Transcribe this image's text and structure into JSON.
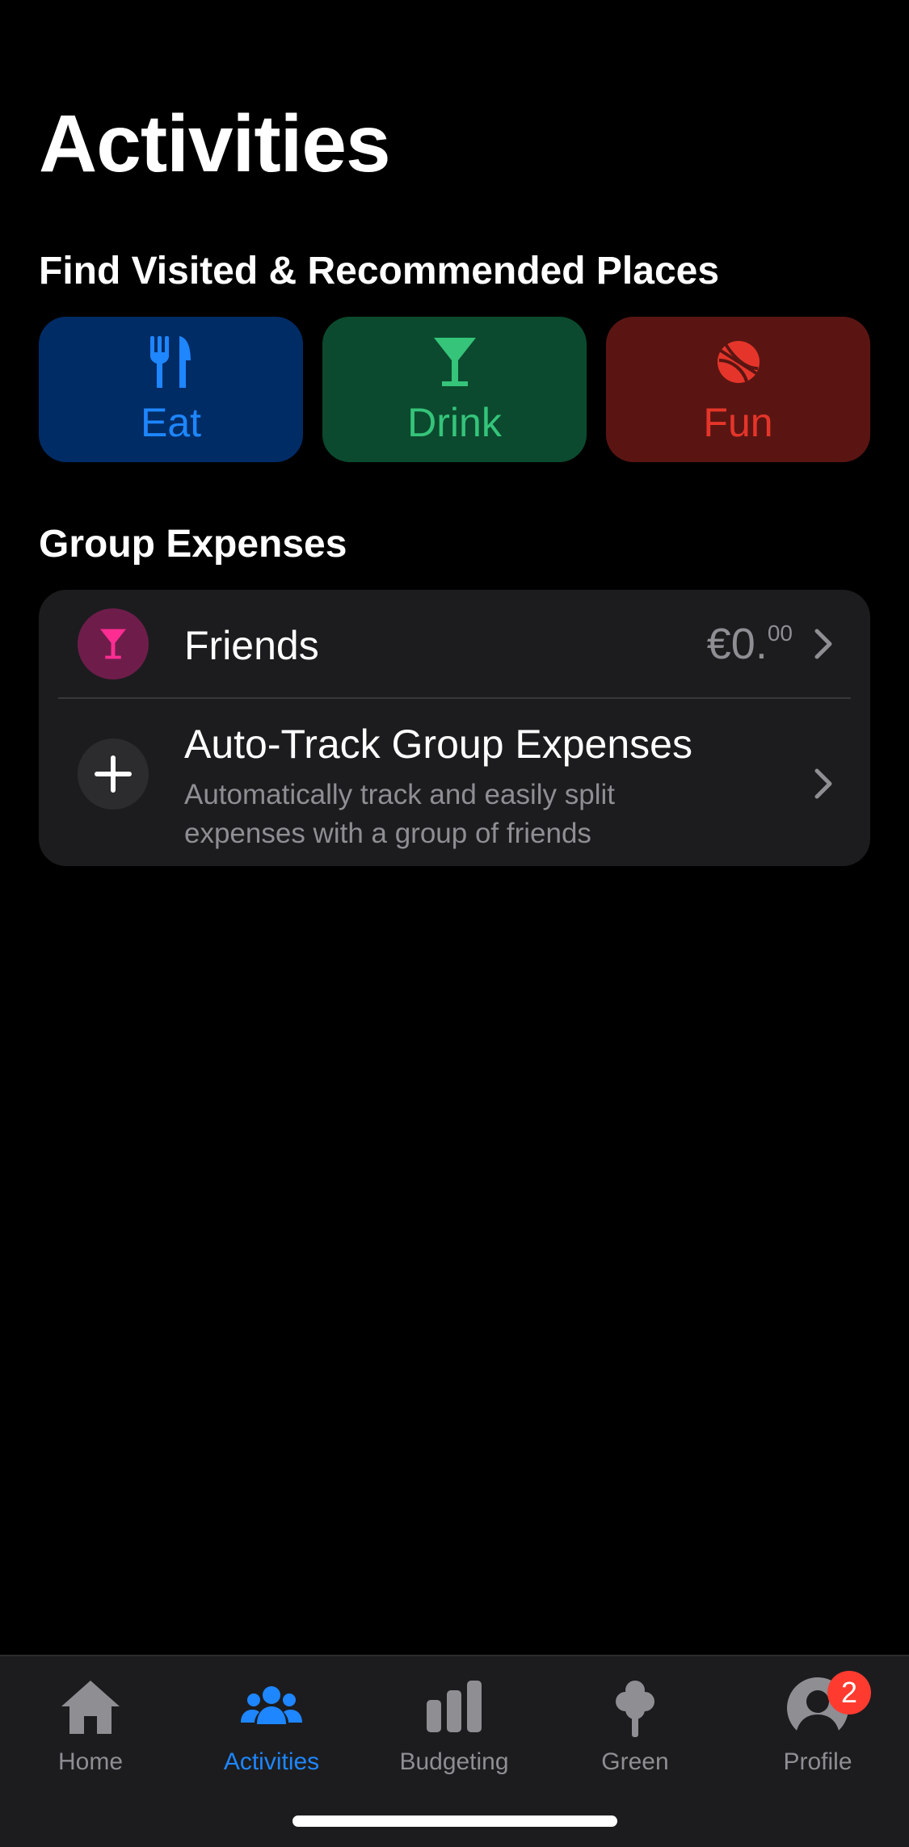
{
  "header": {
    "title": "Activities"
  },
  "places": {
    "heading": "Find Visited & Recommended Places",
    "categories": [
      {
        "label": "Eat",
        "icon": "fork-knife-icon",
        "color": "#1e86ff"
      },
      {
        "label": "Drink",
        "icon": "cocktail-icon",
        "color": "#35c47a"
      },
      {
        "label": "Fun",
        "icon": "basketball-icon",
        "color": "#e5352a"
      }
    ]
  },
  "expenses": {
    "heading": "Group Expenses",
    "friends": {
      "name": "Friends",
      "amount_main": "€0.",
      "amount_cents": "00",
      "icon": "cocktail-icon"
    },
    "auto_track": {
      "title": "Auto-Track Group Expenses",
      "subtitle": "Automatically track and easily split expenses with a group of friends",
      "icon": "plus-icon"
    }
  },
  "tabbar": {
    "tabs": [
      {
        "label": "Home",
        "icon": "house-icon",
        "active": false
      },
      {
        "label": "Activities",
        "icon": "people-icon",
        "active": true
      },
      {
        "label": "Budgeting",
        "icon": "bar-chart-icon",
        "active": false
      },
      {
        "label": "Green",
        "icon": "tree-icon",
        "active": false
      },
      {
        "label": "Profile",
        "icon": "person-icon",
        "active": false,
        "badge": "2"
      }
    ]
  }
}
